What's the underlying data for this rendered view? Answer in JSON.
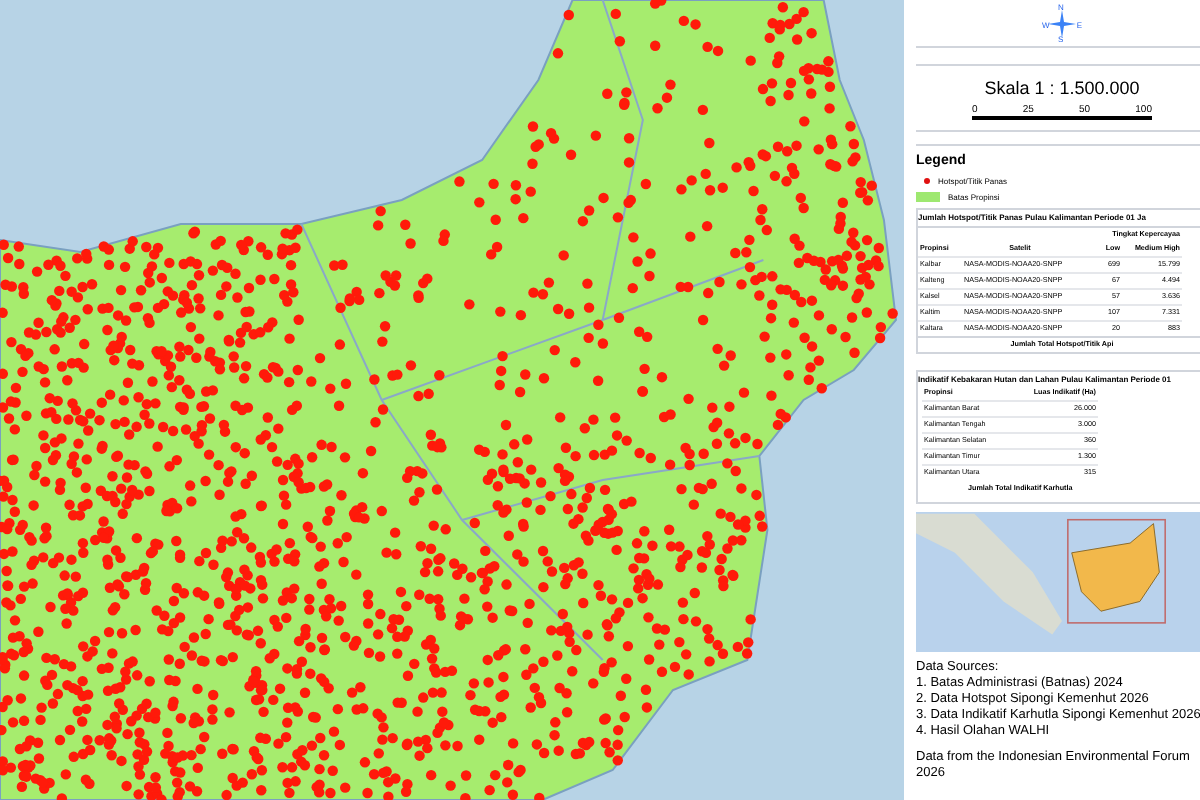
{
  "compass": {
    "north": "N",
    "east": "E",
    "south": "S",
    "west": "W"
  },
  "scale": {
    "label": "Skala 1 : 1.500.000",
    "ticks": [
      "0",
      "25",
      "50",
      "100"
    ]
  },
  "legend": {
    "title": "Legend",
    "items": [
      {
        "kind": "dot",
        "label": "Hotspot/Titik Panas",
        "color": "#e01010"
      },
      {
        "kind": "area",
        "label": "Batas Propinsi",
        "color": "#9ee870"
      }
    ]
  },
  "hotspot_table": {
    "title": "Jumlah Hotspot/Titik Panas Pulau Kalimantan Periode 01 Ja",
    "group_header": "Tingkat Kepercayaa",
    "columns": [
      "Propinsi",
      "Satelit",
      "Low",
      "Medium High"
    ],
    "rows": [
      [
        "Kalbar",
        "NASA-MODIS-NOAA20-SNPP",
        "699",
        "15.799"
      ],
      [
        "Kalteng",
        "NASA-MODIS-NOAA20-SNPP",
        "67",
        "4.494"
      ],
      [
        "Kalsel",
        "NASA-MODIS-NOAA20-SNPP",
        "57",
        "3.636"
      ],
      [
        "Kaltim",
        "NASA-MODIS-NOAA20-SNPP",
        "107",
        "7.331"
      ],
      [
        "Kaltara",
        "NASA-MODIS-NOAA20-SNPP",
        "20",
        "883"
      ]
    ],
    "footer": "Jumlah Total Hotspot/Titik Api"
  },
  "burn_table": {
    "title": "Indikatif Kebakaran Hutan dan Lahan Pulau Kalimantan Periode 01",
    "columns": [
      "Propinsi",
      "Luas Indikatif (Ha)"
    ],
    "rows": [
      [
        "Kalimantan Barat",
        "26.000"
      ],
      [
        "Kalimantan Tengah",
        "3.000"
      ],
      [
        "Kalimantan Selatan",
        "360"
      ],
      [
        "Kalimantan Timur",
        "1.300"
      ],
      [
        "Kalimantan Utara",
        "315"
      ]
    ],
    "footer": "Jumlah Total Indikatif Karhutla"
  },
  "sources": {
    "title": "Data Sources:",
    "lines": [
      "1. Batas Administrasi (Batnas) 2024",
      "2. Data Hotspot Sipongi Kemenhut 2026",
      "3. Data Indikatif Karhutla Sipongi Kemenhut 2026",
      "4. Hasil Olahan WALHI"
    ],
    "note": "Data from the Indonesian Environmental Forum 2026"
  }
}
